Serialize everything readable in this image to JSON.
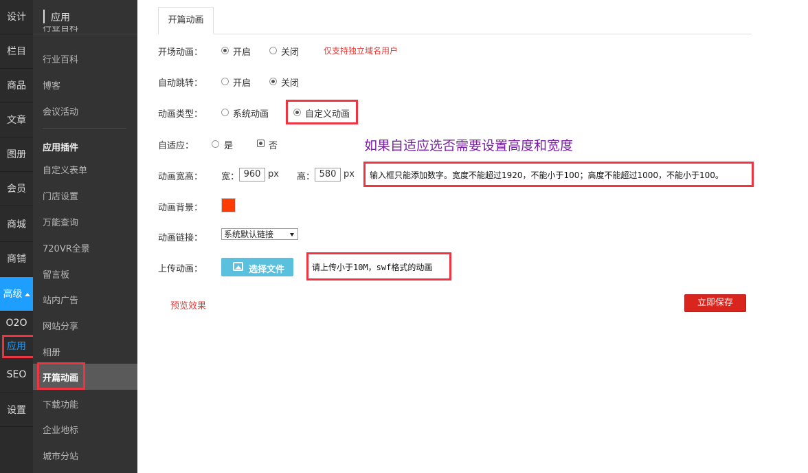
{
  "rail": {
    "items": [
      "设计",
      "栏目",
      "商品",
      "文章",
      "图册",
      "会员",
      "商城",
      "商铺",
      "高级",
      "O2O",
      "应用",
      "SEO",
      "设置"
    ]
  },
  "sidebar": {
    "title": "应用",
    "cut_item": "行业百科",
    "items": [
      "行业百科",
      "博客",
      "会议活动"
    ],
    "group_title": "应用插件",
    "plugin_items": [
      "自定义表单",
      "门店设置",
      "万能查询",
      "720VR全景",
      "留言板",
      "站内广告",
      "网站分享",
      "相册",
      "开篇动画",
      "下载功能",
      "企业地标",
      "城市分站"
    ]
  },
  "tab": {
    "label": "开篇动画"
  },
  "form": {
    "opening": {
      "label": "开场动画：",
      "on": "开启",
      "off": "关闭",
      "selected": "on",
      "note": "仅支持独立域名用户"
    },
    "autojump": {
      "label": "自动跳转：",
      "on": "开启",
      "off": "关闭",
      "selected": "off"
    },
    "type": {
      "label": "动画类型：",
      "system": "系统动画",
      "custom": "自定义动画",
      "selected": "custom"
    },
    "adaptive": {
      "label": "自适应：",
      "yes": "是",
      "no": "否",
      "selected": "no",
      "annotation": "如果自适应选否需要设置高度和宽度"
    },
    "size": {
      "label": "动画宽高：",
      "width_label": "宽：",
      "width": "960",
      "height_label": "高：",
      "height": "580",
      "unit": "px",
      "note": "输入框只能添加数字。宽度不能超过1920，不能小于100；高度不能超过1000，不能小于100。"
    },
    "background": {
      "label": "动画背景：",
      "color": "#ff3c00"
    },
    "link": {
      "label": "动画链接：",
      "value": "系统默认链接"
    },
    "upload": {
      "label": "上传动画：",
      "button": "选择文件",
      "note": "请上传小于10M，swf格式的动画"
    },
    "preview": "预览效果",
    "save": "立即保存"
  },
  "colors": {
    "highlight_box": "#ef3340",
    "accent_blue": "#1e9fff",
    "save_red": "#d9251d"
  }
}
